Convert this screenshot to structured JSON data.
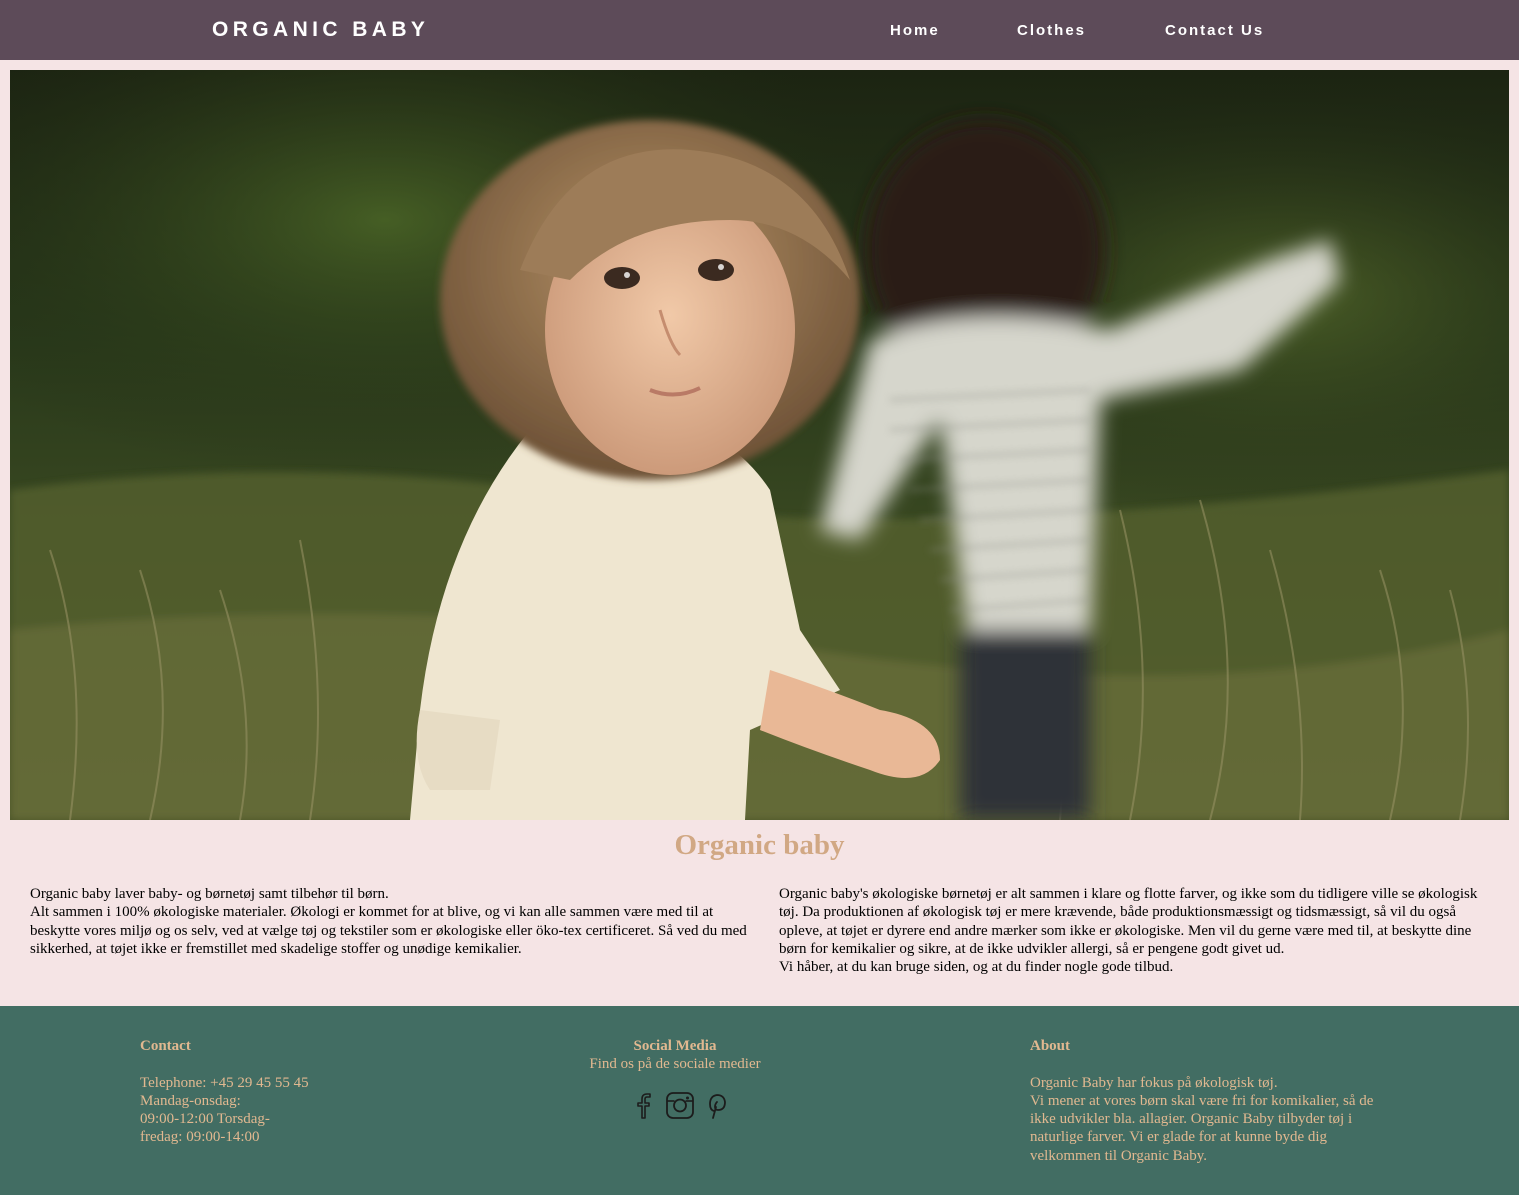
{
  "nav": {
    "brand": "ORGANIC BABY",
    "links": [
      "Home",
      "Clothes",
      "Contact Us"
    ]
  },
  "colors": {
    "nav_bg": "#5d4b59",
    "page_bg": "#f5e4e5",
    "accent": "#d1a884",
    "footer_bg": "#426d63",
    "footer_text": "#e1b890"
  },
  "hero": {
    "image": "toddler-in-meadow-photo"
  },
  "intro": {
    "title": "Organic baby",
    "paragraphs": [
      "Organic baby laver baby- og børnetøj samt tilbehør til børn.",
      "Alt sammen i 100% økologiske materialer. Økologi er kommet for at blive, og vi kan alle sammen være med til at beskytte vores miljø og os selv, ved at vælge tøj og tekstiler som er økologiske eller öko-tex certificeret. Så ved du med sikkerhed, at tøjet ikke er fremstillet med skadelige stoffer og unødige kemikalier.",
      "Organic baby's økologiske børnetøj er alt sammen i klare og flotte farver, og ikke som du tidligere ville se økologisk tøj. Da produktionen af økologisk tøj er mere krævende, både produktionsmæssigt og tidsmæssigt, så vil du også opleve, at tøjet er dyrere end andre mærker som ikke er økologiske. Men vil du gerne være med til, at beskytte dine børn for kemikalier og sikre, at de ikke udvikler allergi, så er pengene godt givet ud.",
      "Vi håber, at du kan bruge siden, og at du finder nogle gode tilbud."
    ]
  },
  "footer": {
    "contact": {
      "title": "Contact",
      "phone": "Telephone: +45 29 45 55 45",
      "hours_1": "Mandag-onsdag:",
      "hours_2": "09:00-12:00 Torsdag-",
      "hours_3": "fredag: 09:00-14:00"
    },
    "social": {
      "title": "Social Media",
      "subtitle": "Find os på de sociale medier",
      "icons": [
        "facebook-icon",
        "instagram-icon",
        "pinterest-icon"
      ]
    },
    "about": {
      "title": "About",
      "line_1": "Organic Baby har fokus på økologisk tøj.",
      "text": "Vi mener at vores børn skal være fri for komikalier, så de ikke udvikler bla. allagier. Organic Baby tilbyder tøj i naturlige farver. Vi er glade for at kunne byde dig velkommen til Organic Baby."
    }
  }
}
